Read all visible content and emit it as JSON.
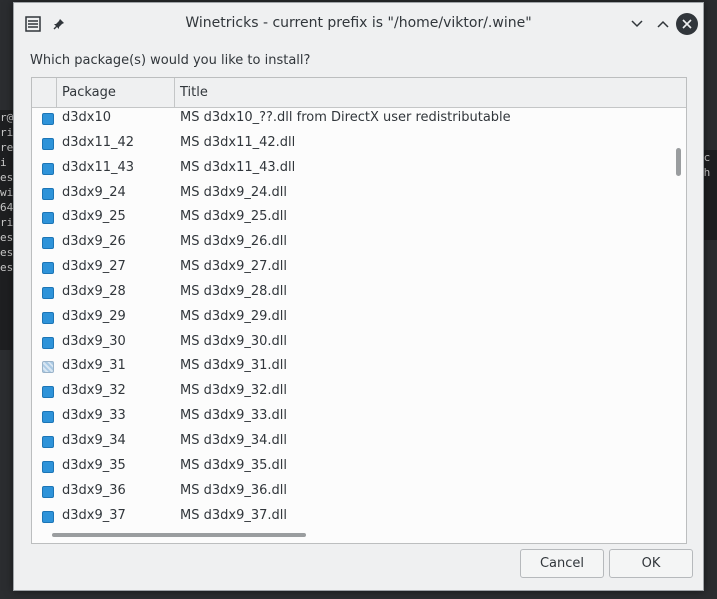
{
  "window": {
    "title": "Winetricks - current prefix is \"/home/viktor/.wine\"",
    "prompt": "Which package(s) would you like to install?"
  },
  "background_terminal": {
    "left_lines": [
      "r@",
      "ri",
      "re",
      "i",
      "ess",
      "wi",
      "64",
      "ri",
      "ess",
      "ess",
      "ess"
    ],
    "right_lines": [
      "nc",
      "",
      "th"
    ]
  },
  "table": {
    "columns": [
      "Package",
      "Title"
    ],
    "rows": [
      {
        "package": "d3dx10",
        "title": "MS d3dx10_??.dll from DirectX user redistributable",
        "state": "checked"
      },
      {
        "package": "d3dx11_42",
        "title": "MS d3dx11_42.dll",
        "state": "checked"
      },
      {
        "package": "d3dx11_43",
        "title": "MS d3dx11_43.dll",
        "state": "checked"
      },
      {
        "package": "d3dx9_24",
        "title": "MS d3dx9_24.dll",
        "state": "checked"
      },
      {
        "package": "d3dx9_25",
        "title": "MS d3dx9_25.dll",
        "state": "checked"
      },
      {
        "package": "d3dx9_26",
        "title": "MS d3dx9_26.dll",
        "state": "checked"
      },
      {
        "package": "d3dx9_27",
        "title": "MS d3dx9_27.dll",
        "state": "checked"
      },
      {
        "package": "d3dx9_28",
        "title": "MS d3dx9_28.dll",
        "state": "checked"
      },
      {
        "package": "d3dx9_29",
        "title": "MS d3dx9_29.dll",
        "state": "checked"
      },
      {
        "package": "d3dx9_30",
        "title": "MS d3dx9_30.dll",
        "state": "checked"
      },
      {
        "package": "d3dx9_31",
        "title": "MS d3dx9_31.dll",
        "state": "partial"
      },
      {
        "package": "d3dx9_32",
        "title": "MS d3dx9_32.dll",
        "state": "checked"
      },
      {
        "package": "d3dx9_33",
        "title": "MS d3dx9_33.dll",
        "state": "checked"
      },
      {
        "package": "d3dx9_34",
        "title": "MS d3dx9_34.dll",
        "state": "checked"
      },
      {
        "package": "d3dx9_35",
        "title": "MS d3dx9_35.dll",
        "state": "checked"
      },
      {
        "package": "d3dx9_36",
        "title": "MS d3dx9_36.dll",
        "state": "checked"
      },
      {
        "package": "d3dx9_37",
        "title": "MS d3dx9_37.dll",
        "state": "checked"
      }
    ]
  },
  "buttons": {
    "cancel": "Cancel",
    "ok": "OK"
  },
  "icons": {
    "app": "list-icon",
    "pin": "pin-icon",
    "minimize": "chevron-down-icon",
    "maximize": "chevron-up-icon",
    "close": "close-icon"
  },
  "colors": {
    "checkbox": "#2e93d9",
    "window_bg": "#eff0f1",
    "list_bg": "#fcfcfc"
  }
}
